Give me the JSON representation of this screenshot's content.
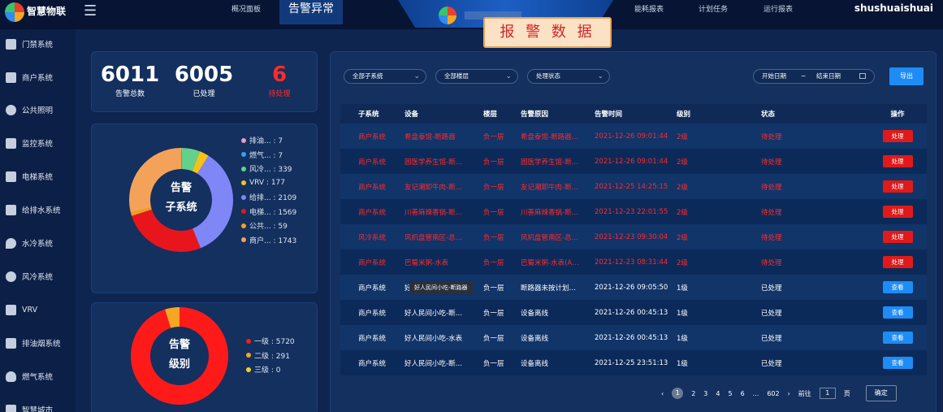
{
  "header": {
    "brand": "智慧物联",
    "nav": [
      "概况面板",
      "告警异常",
      "能耗报表",
      "计划任务",
      "运行报表"
    ],
    "active_nav": "告警异常",
    "report_tag": "报 警 数 据",
    "user": "shushuaishuai"
  },
  "sidebar": {
    "items": [
      {
        "label": "门禁系统",
        "icon": "door-icon"
      },
      {
        "label": "商户系统",
        "icon": "shop-icon"
      },
      {
        "label": "公共照明",
        "icon": "bulb-icon"
      },
      {
        "label": "监控系统",
        "icon": "camera-icon"
      },
      {
        "label": "电梯系统",
        "icon": "elevator-icon"
      },
      {
        "label": "给排水系统",
        "icon": "water-pipe-icon"
      },
      {
        "label": "水冷系统",
        "icon": "water-drop-icon"
      },
      {
        "label": "风冷系统",
        "icon": "fan-icon"
      },
      {
        "label": "VRV",
        "icon": "vrv-icon"
      },
      {
        "label": "排油烟系统",
        "icon": "exhaust-icon"
      },
      {
        "label": "燃气系统",
        "icon": "flame-icon"
      },
      {
        "label": "智慧城市",
        "icon": "city-icon"
      }
    ]
  },
  "stats": {
    "total": {
      "value": "6011",
      "label": "告警总数"
    },
    "handled": {
      "value": "6005",
      "label": "已处理"
    },
    "pending": {
      "value": "6",
      "label": "待处理"
    }
  },
  "subsystem_chart": {
    "center_line1": "告警",
    "center_line2": "子系统",
    "legend": [
      {
        "label": "排油... : 7",
        "color": "#e99bc7"
      },
      {
        "label": "燃气... : 7",
        "color": "#3aa0f0"
      },
      {
        "label": "风冷... : 339",
        "color": "#64d08a"
      },
      {
        "label": "VRV : 177",
        "color": "#f5c21b"
      },
      {
        "label": "给排... : 2109",
        "color": "#7f86f5"
      },
      {
        "label": "电梯... : 1569",
        "color": "#e8161c"
      },
      {
        "label": "公共... : 59",
        "color": "#f3a01c"
      },
      {
        "label": "商户... : 1743",
        "color": "#f4a259"
      }
    ]
  },
  "level_chart": {
    "center_line1": "告警",
    "center_line2": "级别",
    "legend": [
      {
        "label": "一级 : 5720",
        "color": "#ff1a1a"
      },
      {
        "label": "二级 : 291",
        "color": "#f5a623"
      },
      {
        "label": "三级 : 0",
        "color": "#f5d21b"
      }
    ]
  },
  "chart_data": [
    {
      "type": "pie",
      "categories": [
        "排油...",
        "燃气...",
        "风冷...",
        "VRV",
        "给排...",
        "电梯...",
        "公共...",
        "商户..."
      ],
      "values": [
        7,
        7,
        339,
        177,
        2109,
        1569,
        59,
        1743
      ],
      "colors": [
        "#e99bc7",
        "#3aa0f0",
        "#64d08a",
        "#f5c21b",
        "#7f86f5",
        "#e8161c",
        "#f3a01c",
        "#f4a259"
      ]
    },
    {
      "type": "pie",
      "categories": [
        "一级",
        "二级",
        "三级"
      ],
      "values": [
        5720,
        291,
        0
      ],
      "colors": [
        "#ff1a1a",
        "#f5a623",
        "#f5d21b"
      ]
    }
  ],
  "filters": {
    "subsystem": "全部子系统",
    "floor": "全部楼层",
    "status": "处理状态",
    "start_date": "开始日期",
    "range_sep": "~",
    "end_date": "结束日期",
    "export": "导出"
  },
  "table": {
    "headers": [
      "子系统",
      "设备",
      "楼层",
      "告警原因",
      "告警时间",
      "级别",
      "状态",
      "操作"
    ],
    "rows": [
      {
        "subsystem": "商户系统",
        "device": "希盘泰馆-断路器",
        "floor": "负一层",
        "reason": "希盘泰馆-断路器…",
        "time": "2021-12-26 09:01:44",
        "level": "2级",
        "status": "待处理",
        "action": "处理",
        "alert": true
      },
      {
        "subsystem": "商户系统",
        "device": "固医学养生馆-断…",
        "floor": "负一层",
        "reason": "固医学养生馆-断…",
        "time": "2021-12-26 09:01:44",
        "level": "2级",
        "status": "待处理",
        "action": "处理",
        "alert": true
      },
      {
        "subsystem": "商户系统",
        "device": "友记潮卸牛肉-断…",
        "floor": "负一层",
        "reason": "友记潮卸牛肉-断…",
        "time": "2021-12-25 14:25:15",
        "level": "2级",
        "status": "待处理",
        "action": "处理",
        "alert": true
      },
      {
        "subsystem": "商户系统",
        "device": "川善麻辣香锅-断…",
        "floor": "负一层",
        "reason": "川善麻辣香锅-断…",
        "time": "2021-12-23 22:01:55",
        "level": "2级",
        "status": "待处理",
        "action": "处理",
        "alert": true
      },
      {
        "subsystem": "风冷系统",
        "device": "风机盘管南区-总…",
        "floor": "负一层",
        "reason": "风机盘管南区-总…",
        "time": "2021-12-23 09:30:04",
        "level": "2级",
        "status": "待处理",
        "action": "处理",
        "alert": true
      },
      {
        "subsystem": "商户系统",
        "device": "巴蜀米粥-水表",
        "floor": "负一层",
        "reason": "巴蜀米粥-水表(A…",
        "time": "2021-12-23 08:31:44",
        "level": "2级",
        "status": "待处理",
        "action": "处理",
        "alert": true
      },
      {
        "subsystem": "商户系统",
        "device": "好人民间小吃-断路器",
        "floor": "负一层",
        "reason": "断路器未按计划…",
        "time": "2021-12-26 09:05:50",
        "level": "1级",
        "status": "已处理",
        "action": "查看",
        "alert": false
      },
      {
        "subsystem": "商户系统",
        "device": "好人民间小吃-断…",
        "floor": "负一层",
        "reason": "设备离线",
        "time": "2021-12-26 00:45:13",
        "level": "1级",
        "status": "已处理",
        "action": "查看",
        "alert": false
      },
      {
        "subsystem": "商户系统",
        "device": "好人民间小吃-水表",
        "floor": "负一层",
        "reason": "设备离线",
        "time": "2021-12-26 00:45:13",
        "level": "1级",
        "status": "已处理",
        "action": "查看",
        "alert": false
      },
      {
        "subsystem": "商户系统",
        "device": "好人民间小吃-断…",
        "floor": "负一层",
        "reason": "设备离线",
        "time": "2021-12-25 23:51:13",
        "level": "1级",
        "status": "已处理",
        "action": "查看",
        "alert": false
      }
    ]
  },
  "tooltip": "好人民间小吃-断路器",
  "pager": {
    "prev": "‹",
    "pages": [
      "1",
      "2",
      "3",
      "4",
      "5",
      "6",
      "...",
      "602"
    ],
    "current": "1",
    "next": "›",
    "goto_label": "前往",
    "goto_value": "1",
    "page_unit": "页",
    "confirm": "确定"
  }
}
